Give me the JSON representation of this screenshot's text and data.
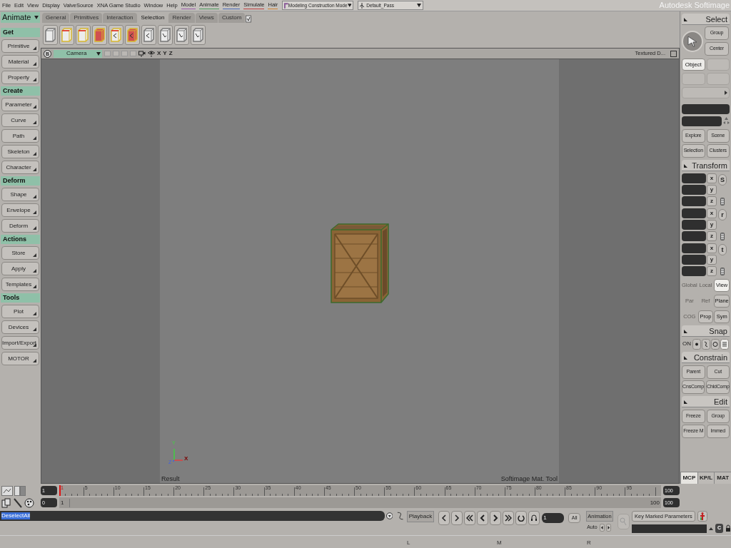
{
  "menu_bar": {
    "menus": [
      {
        "label": "File"
      },
      {
        "label": "Edit"
      },
      {
        "label": "View"
      },
      {
        "label": "Display"
      },
      {
        "label": "ValveSource"
      },
      {
        "label": "XNA Game Studio"
      },
      {
        "label": "Window"
      },
      {
        "label": "Help"
      },
      {
        "label": "Model",
        "color": "#9a5aa8"
      },
      {
        "label": "Animate",
        "color": "#4a9a5a"
      },
      {
        "label": "Render",
        "color": "#4a6ab8"
      },
      {
        "label": "Simulate",
        "color": "#c04040"
      },
      {
        "label": "Hair",
        "color": "#d08030"
      }
    ],
    "mode_dropdown": "Modeling Construction Mode",
    "pass_dropdown": "Default_Pass",
    "brand": "Autodesk Softimage"
  },
  "left_panel": {
    "module": "Animate",
    "sections": [
      {
        "title": "Get",
        "buttons": [
          "Primitive",
          "Material",
          "Property"
        ]
      },
      {
        "title": "Create",
        "buttons": [
          "Parameter",
          "Curve",
          "Path",
          "Skeleton",
          "Character"
        ]
      },
      {
        "title": "Deform",
        "buttons": [
          "Shape",
          "Envelope",
          "Deform"
        ]
      },
      {
        "title": "Actions",
        "buttons": [
          "Store",
          "Apply",
          "Templates"
        ]
      },
      {
        "title": "Tools",
        "buttons": [
          "Plot",
          "Devices",
          "Import/Export",
          "MOTOR"
        ]
      }
    ]
  },
  "toolbar_tabs": [
    {
      "label": "General",
      "selected": false
    },
    {
      "label": "Primitives",
      "selected": false
    },
    {
      "label": "Interaction",
      "selected": false
    },
    {
      "label": "Selection",
      "selected": true
    },
    {
      "label": "Render",
      "selected": false
    },
    {
      "label": "Views",
      "selected": false
    },
    {
      "label": "Custom",
      "selected": false
    }
  ],
  "viewport": {
    "badge": "B",
    "camera": "Camera",
    "axes": [
      "X",
      "Y",
      "Z"
    ],
    "display_mode": "Textured D...",
    "bottom_left": "Result",
    "bottom_right": "Softimage Mat. Tool",
    "gizmo_labels": {
      "y": "Y",
      "x": "X",
      "z": "Z"
    }
  },
  "right_panel": {
    "select": {
      "title": "Select",
      "buttons": [
        "Group",
        "Center"
      ],
      "filter": {
        "label": "Object",
        "selected": true
      },
      "explore_buttons": [
        "Explore",
        "Scene",
        "Selection",
        "Clusters"
      ]
    },
    "transform": {
      "title": "Transform",
      "groups": [
        {
          "symbol": "S",
          "axes": [
            "x",
            "y",
            "z"
          ]
        },
        {
          "symbol": "r",
          "axes": [
            "x",
            "y",
            "z"
          ]
        },
        {
          "symbol": "t",
          "axes": [
            "x",
            "y",
            "z"
          ]
        }
      ],
      "option_rows": [
        [
          {
            "label": "Global",
            "selected": false,
            "disabled": true
          },
          {
            "label": "Local",
            "selected": false,
            "disabled": true
          },
          {
            "label": "View",
            "selected": true,
            "disabled": false
          }
        ],
        [
          {
            "label": "Par",
            "selected": false,
            "disabled": true
          },
          {
            "label": "Ref",
            "selected": false,
            "disabled": true
          },
          {
            "label": "Plane",
            "selected": false,
            "disabled": false
          }
        ],
        [
          {
            "label": "COG",
            "selected": false,
            "disabled": true
          },
          {
            "label": "Prop",
            "selected": false,
            "disabled": false
          },
          {
            "label": "Sym",
            "selected": false,
            "disabled": false
          }
        ]
      ]
    },
    "snap": {
      "title": "Snap",
      "on_label": "ON"
    },
    "constrain": {
      "title": "Constrain",
      "buttons": [
        "Parent",
        "Cut",
        "CnsComp",
        "ChldComp"
      ]
    },
    "edit": {
      "title": "Edit",
      "buttons": [
        "Freeze",
        "Group",
        "Freeze M",
        "Immed"
      ]
    },
    "tabs": [
      {
        "label": "MCP",
        "selected": true
      },
      {
        "label": "KP/L",
        "selected": false
      },
      {
        "label": "MAT",
        "selected": false
      }
    ]
  },
  "timeline": {
    "current_frame": "1",
    "start": "0",
    "ruler_labels": [
      "1",
      "5",
      "10",
      "15",
      "20",
      "25",
      "30",
      "35",
      "40",
      "45",
      "50",
      "55",
      "60",
      "65",
      "70",
      "75",
      "80",
      "85",
      "90",
      "95"
    ],
    "end": "100",
    "range_start": "1",
    "range_end_label": "100",
    "range_end": "100"
  },
  "command_line": {
    "text": "DeselectAll",
    "text_selected": true
  },
  "playback": {
    "label": "Playback",
    "frame": "1",
    "all": "All",
    "animation": "Animation",
    "auto": "Auto",
    "key_button": "Key Marked Parameters",
    "copy": "C"
  },
  "markers": [
    "L",
    "M",
    "R"
  ]
}
